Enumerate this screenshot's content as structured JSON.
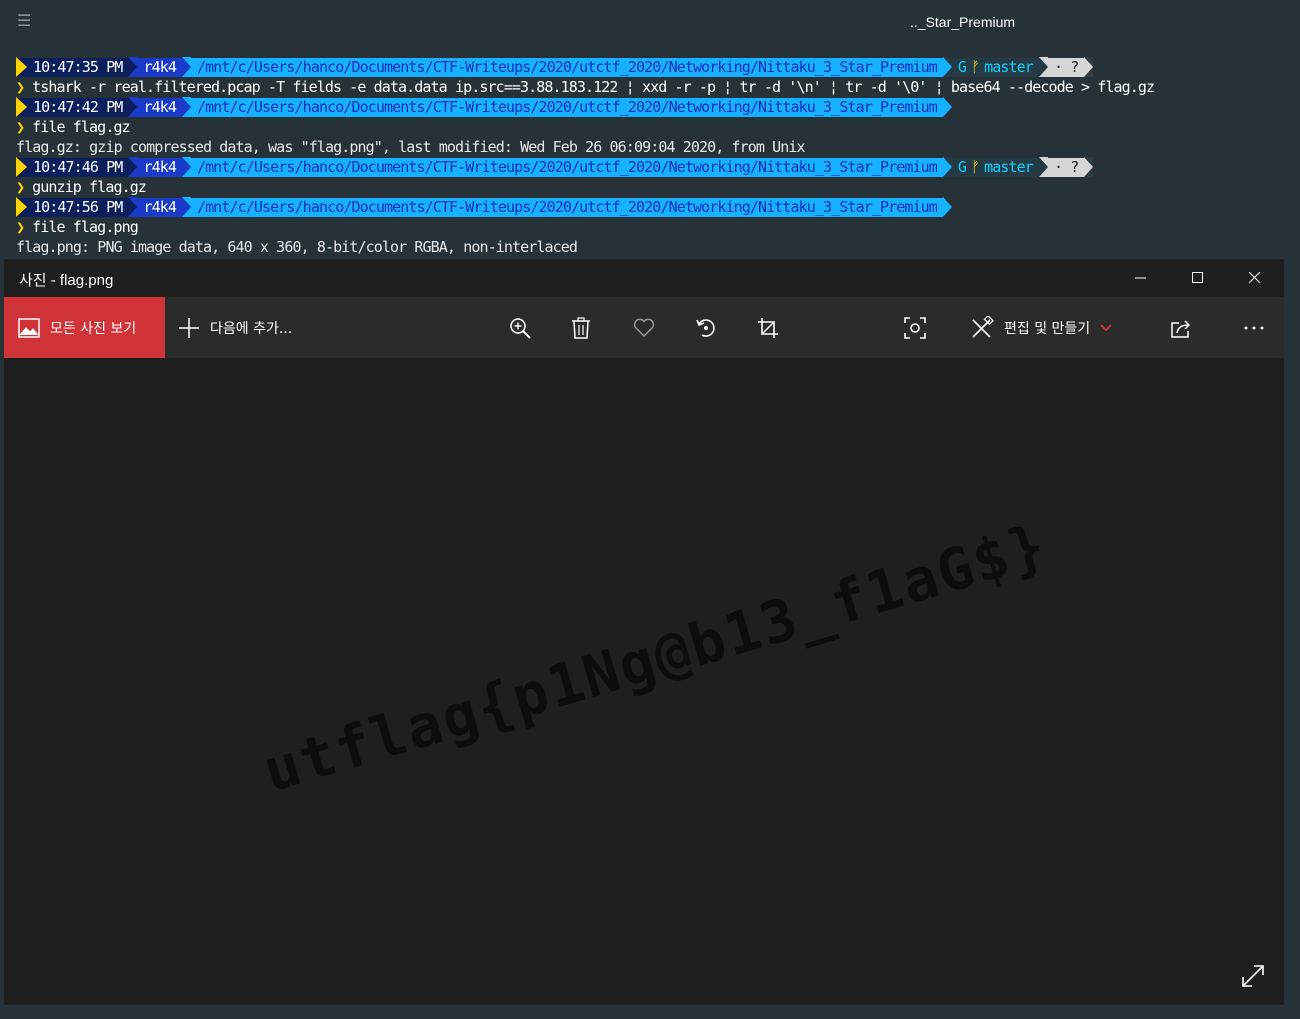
{
  "terminal": {
    "title": ".._Star_Premium",
    "menu_icon": "hamburger-icon",
    "lines": [
      {
        "type": "prompt",
        "time": "10:47:35 PM",
        "user": "r4k4",
        "path": "/mnt/c/Users/hanco/Documents/CTF-Writeups/2020/utctf_2020/Networking/Nittaku_3_Star_Premium",
        "git_symbol": "G",
        "branch": "master",
        "status": "· ?"
      },
      {
        "type": "command",
        "text": "tshark -r real.filtered.pcap -T fields -e data.data ip.src==3.88.183.122 ¦ xxd -r -p ¦ tr -d '\\n' ¦ tr -d '\\0' ¦ base64 --decode > flag.gz"
      },
      {
        "type": "prompt",
        "time": "10:47:42 PM",
        "user": "r4k4",
        "path": "/mnt/c/Users/hanco/Documents/CTF-Writeups/2020/utctf_2020/Networking/Nittaku_3_Star_Premium"
      },
      {
        "type": "command",
        "text": "file flag.gz"
      },
      {
        "type": "output",
        "text": "flag.gz: gzip compressed data, was \"flag.png\", last modified: Wed Feb 26 06:09:04 2020, from Unix"
      },
      {
        "type": "prompt",
        "time": "10:47:46 PM",
        "user": "r4k4",
        "path": "/mnt/c/Users/hanco/Documents/CTF-Writeups/2020/utctf_2020/Networking/Nittaku_3_Star_Premium",
        "git_symbol": "G",
        "branch": "master",
        "status": "· ?"
      },
      {
        "type": "command",
        "text": "gunzip flag.gz"
      },
      {
        "type": "prompt",
        "time": "10:47:56 PM",
        "user": "r4k4",
        "path": "/mnt/c/Users/hanco/Documents/CTF-Writeups/2020/utctf_2020/Networking/Nittaku_3_Star_Premium"
      },
      {
        "type": "command",
        "text": "file flag.png"
      },
      {
        "type": "output",
        "text": "flag.png: PNG image data, 640 x 360, 8-bit/color RGBA, non-interlaced"
      }
    ],
    "prompt_char": "❯"
  },
  "photos_app": {
    "title": "사진 - flag.png",
    "window_controls": {
      "minimize": "minimize-icon",
      "maximize": "maximize-icon",
      "close": "close-icon"
    },
    "toolbar": {
      "all_photos_label": "모든 사진 보기",
      "add_to_label": "다음에 추가...",
      "edit_label": "편집 및 만들기",
      "icons": [
        "zoom-in-icon",
        "delete-icon",
        "favorite-icon",
        "rotate-icon",
        "crop-icon",
        "visual-search-icon",
        "share-icon",
        "more-icon"
      ]
    },
    "image_text": "utflag{p1Ng@b13_f1aG$}",
    "accent_color": "#d13438"
  }
}
